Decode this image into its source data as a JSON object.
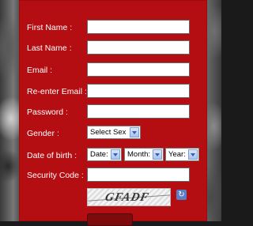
{
  "form": {
    "first_name": {
      "label": "First Name :",
      "value": ""
    },
    "last_name": {
      "label": "Last Name :",
      "value": ""
    },
    "email": {
      "label": "Email :",
      "value": ""
    },
    "reenter_email": {
      "label": "Re-enter Email :",
      "value": ""
    },
    "password": {
      "label": "Password :",
      "value": ""
    },
    "gender": {
      "label": "Gender :",
      "selected": "Select Sex"
    },
    "dob": {
      "label": "Date of birth :",
      "date": "Date:",
      "month": "Month:",
      "year": "Year:"
    },
    "security_code": {
      "label": "Security Code :",
      "value": ""
    },
    "captcha": {
      "code": "GFADF"
    }
  },
  "colors": {
    "panel": "#b50e12",
    "label": "#ffffff"
  }
}
